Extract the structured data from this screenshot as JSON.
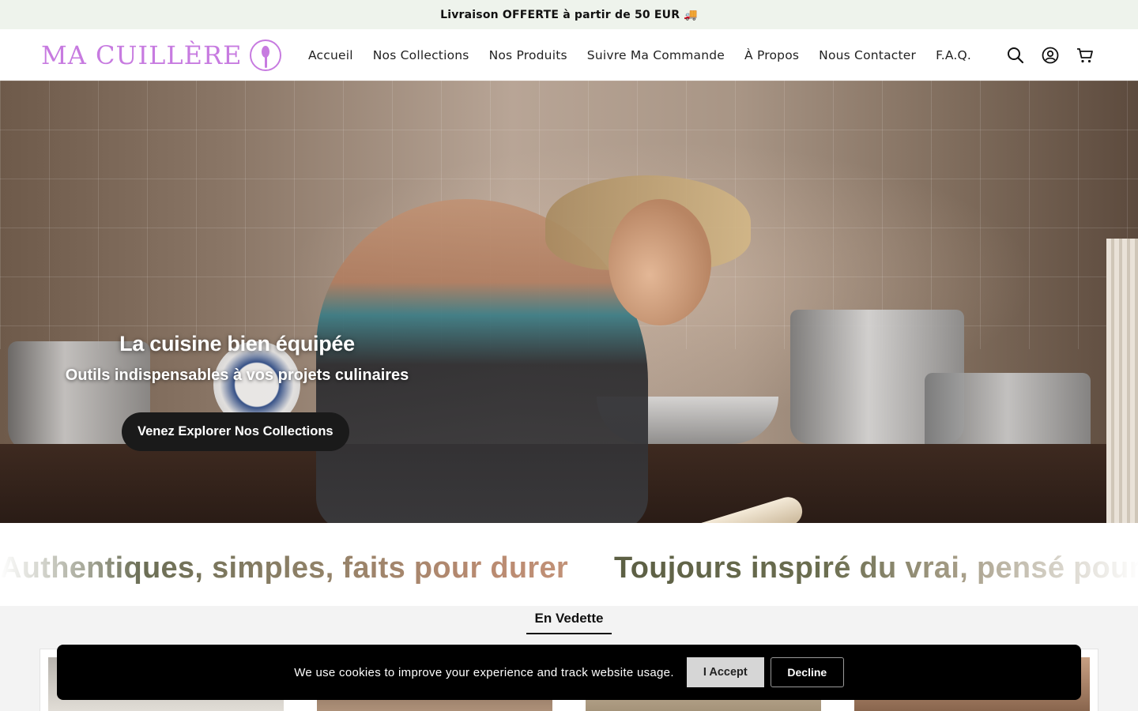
{
  "announcement": {
    "text": "Livraison OFFERTE à partir de 50 EUR",
    "emoji": "🚚"
  },
  "header": {
    "logo_text": "MA CUILLÈRE",
    "nav": [
      "Accueil",
      "Nos Collections",
      "Nos Produits",
      "Suivre Ma Commande",
      "À Propos",
      "Nous Contacter",
      "F.A.Q."
    ],
    "icons": [
      "search-icon",
      "account-icon",
      "cart-icon"
    ]
  },
  "hero": {
    "title": "La cuisine bien équipée",
    "subtitle": "Outils indispensables à vos projets culinaires",
    "cta": "Venez Explorer Nos Collections"
  },
  "marquee": {
    "items": [
      "Authentiques, simples, faits pour durer",
      "Toujours inspiré du vrai, pensé pour"
    ]
  },
  "featured": {
    "tab": "En Vedette"
  },
  "cookie": {
    "text": "We use cookies to improve your experience and track website usage.",
    "accept": "I Accept",
    "decline": "Decline"
  },
  "colors": {
    "brand": "#c77be0",
    "announcement_bg": "#eef3ec",
    "cookie_bg": "#000000"
  }
}
